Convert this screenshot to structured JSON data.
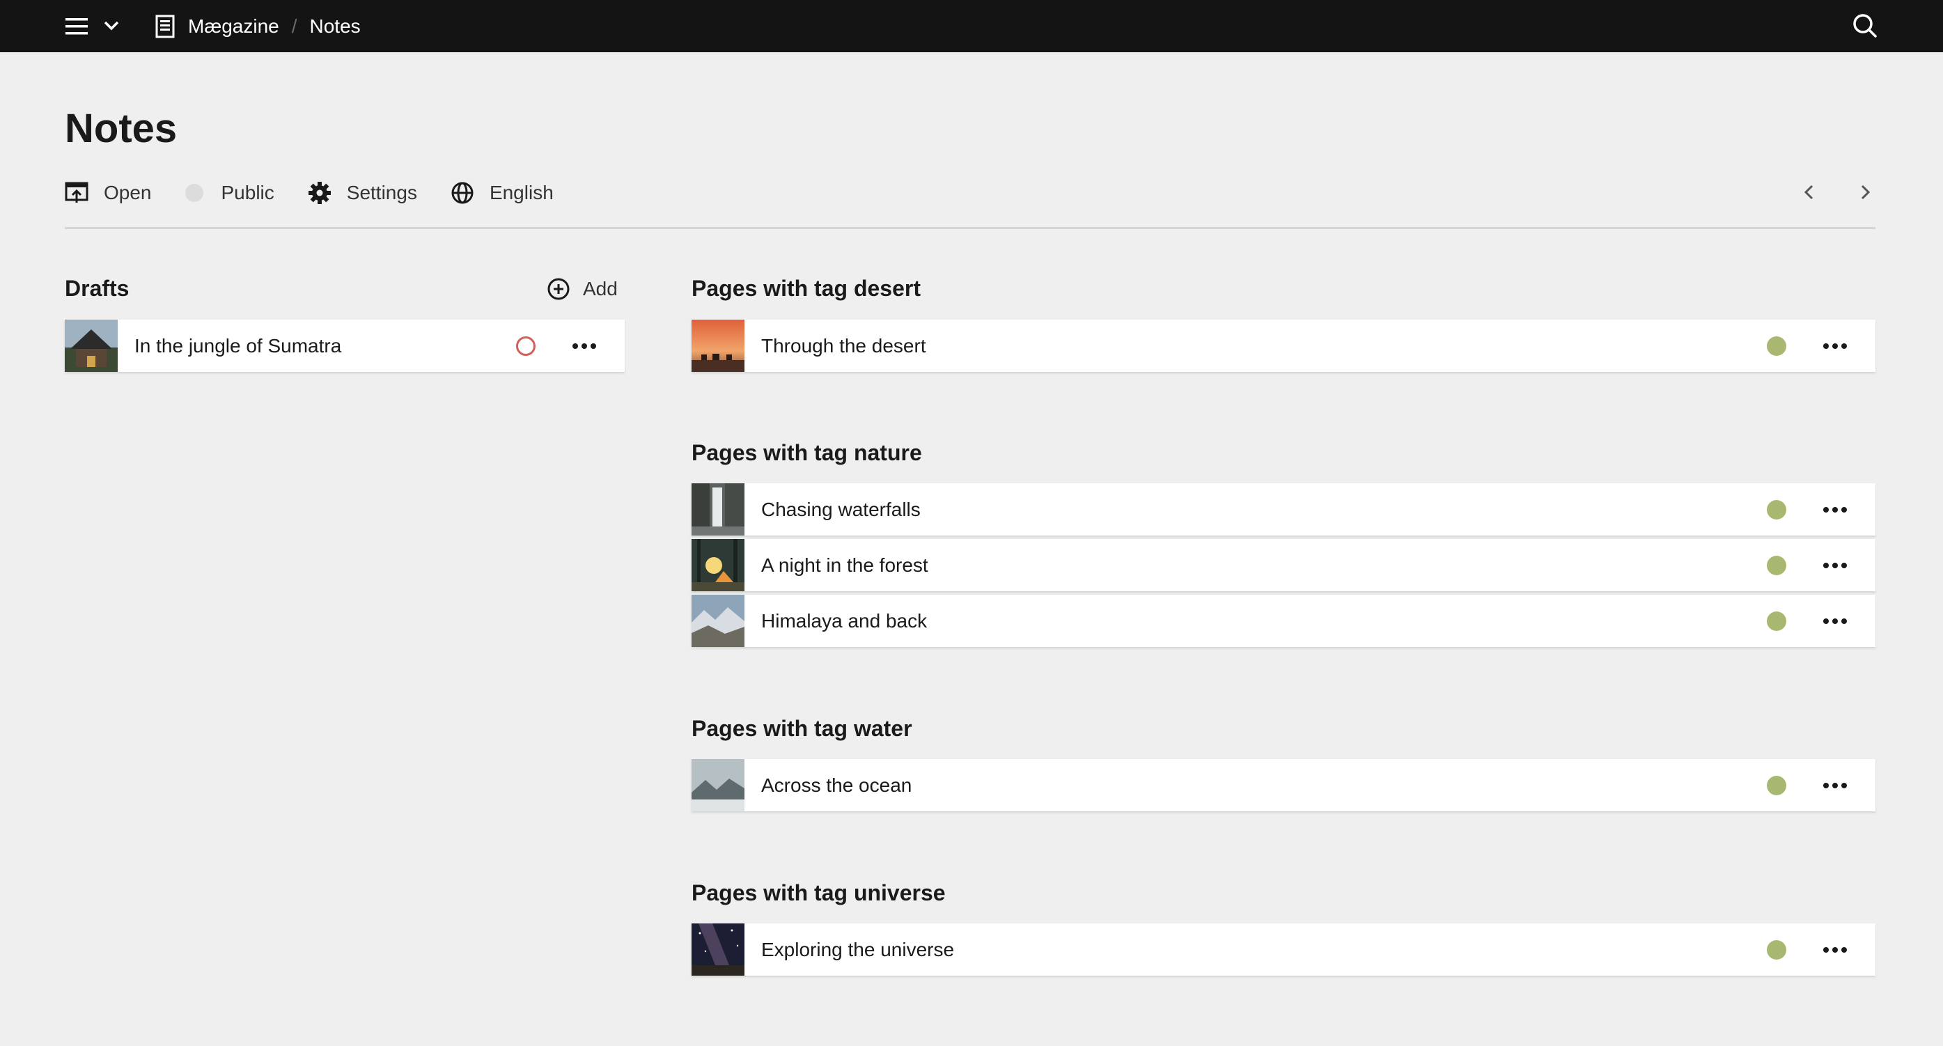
{
  "header": {
    "breadcrumb": [
      {
        "label": "Mægazine"
      },
      {
        "label": "Notes"
      }
    ],
    "separator": "/",
    "icons": [
      "hamburger-icon",
      "chevron-down-icon",
      "document-icon",
      "search-icon"
    ]
  },
  "page": {
    "title": "Notes"
  },
  "toolbar": {
    "open_label": "Open",
    "visibility_label": "Public",
    "settings_label": "Settings",
    "language_label": "English"
  },
  "drafts": {
    "title": "Drafts",
    "add_label": "Add",
    "items": [
      {
        "label": "In the jungle of Sumatra",
        "status": "draft"
      }
    ]
  },
  "sections": [
    {
      "title": "Pages with tag desert",
      "items": [
        {
          "label": "Through the desert",
          "status": "published"
        }
      ]
    },
    {
      "title": "Pages with tag nature",
      "items": [
        {
          "label": "Chasing waterfalls",
          "status": "published"
        },
        {
          "label": "A night in the forest",
          "status": "published"
        },
        {
          "label": "Himalaya and back",
          "status": "published"
        }
      ]
    },
    {
      "title": "Pages with tag water",
      "items": [
        {
          "label": "Across the ocean",
          "status": "published"
        }
      ]
    },
    {
      "title": "Pages with tag universe",
      "items": [
        {
          "label": "Exploring the universe",
          "status": "published"
        }
      ]
    }
  ],
  "colors": {
    "topbar": "#141414",
    "background": "#efefef",
    "published_dot": "#a8b871",
    "draft_ring": "#d0615a"
  }
}
